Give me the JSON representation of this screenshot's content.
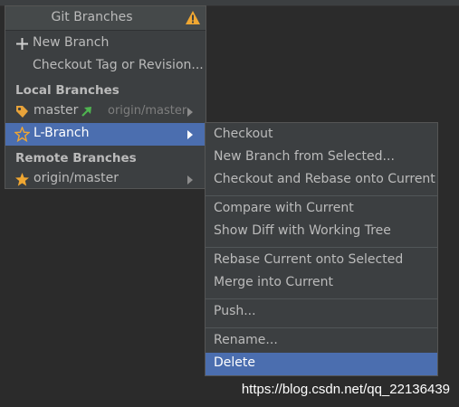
{
  "popup": {
    "title": "Git Branches",
    "actions": {
      "new_branch": "New Branch",
      "checkout_tag": "Checkout Tag or Revision..."
    },
    "local": {
      "header": "Local Branches",
      "master": {
        "label": "master",
        "tracking": "origin/master"
      },
      "l_branch": {
        "label": "L-Branch"
      }
    },
    "remote": {
      "header": "Remote Branches",
      "origin_master": {
        "label": "origin/master"
      }
    }
  },
  "submenu": {
    "checkout": "Checkout",
    "new_branch_from_selected": "New Branch from Selected...",
    "checkout_rebase": "Checkout and Rebase onto Current",
    "compare": "Compare with Current",
    "show_diff": "Show Diff with Working Tree",
    "rebase_current": "Rebase Current onto Selected",
    "merge": "Merge into Current",
    "push": "Push...",
    "rename": "Rename...",
    "delete": "Delete"
  },
  "watermark": "https://blog.csdn.net/qq_22136439",
  "colors": {
    "background": "#2b2b2b",
    "panel": "#3c3f41",
    "selection": "#4b6eaf",
    "warning": "#f0a732",
    "tag_icon": "#e8a33a",
    "star": "#f0a732",
    "incoming_arrow": "#4fb450"
  },
  "icons": {
    "warning": "warning-triangle-icon",
    "new_branch": "plus-icon",
    "master": "tag-icon",
    "master_status": "incoming-arrow-icon",
    "l_branch": "star-outline-icon",
    "origin_master": "star-filled-icon",
    "submenu": "chevron-right-icon"
  }
}
